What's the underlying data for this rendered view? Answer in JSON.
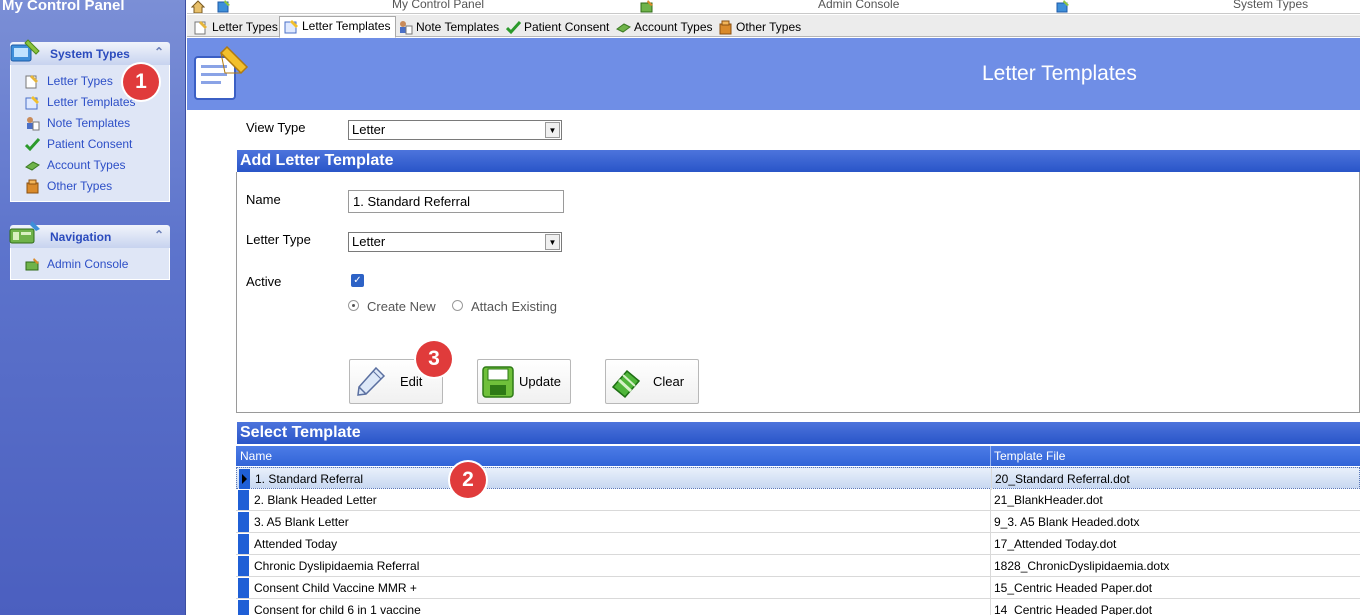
{
  "left_panel": {
    "title": "My Control Panel",
    "system_types": {
      "title": "System Types",
      "items": [
        {
          "label": "Letter Types",
          "icon": "letter-types-icon"
        },
        {
          "label": "Letter Templates",
          "icon": "letter-templates-icon"
        },
        {
          "label": "Note Templates",
          "icon": "note-templates-icon"
        },
        {
          "label": "Patient Consent",
          "icon": "checkmark-icon"
        },
        {
          "label": "Account Types",
          "icon": "account-types-icon"
        },
        {
          "label": "Other Types",
          "icon": "box-icon"
        }
      ]
    },
    "navigation": {
      "title": "Navigation",
      "items": [
        {
          "label": "Admin Console",
          "icon": "admin-console-icon"
        }
      ]
    }
  },
  "top_toolbar": {
    "items": [
      {
        "label": "My Control Panel"
      },
      {
        "label": "Admin Console"
      },
      {
        "label": "System Types"
      }
    ]
  },
  "tabs": [
    {
      "label": "Letter Types",
      "active": false
    },
    {
      "label": "Letter Templates",
      "active": true
    },
    {
      "label": "Note Templates",
      "active": false
    },
    {
      "label": "Patient Consent",
      "active": false
    },
    {
      "label": "Account Types",
      "active": false
    },
    {
      "label": "Other Types",
      "active": false
    }
  ],
  "header": {
    "title": "Letter Templates"
  },
  "form": {
    "view_type_label": "View Type",
    "view_type_value": "Letter",
    "add_section_title": "Add Letter Template",
    "name_label": "Name",
    "name_value": "1. Standard Referral",
    "letter_type_label": "Letter Type",
    "letter_type_value": "Letter",
    "active_label": "Active",
    "active_checked": true,
    "radio_create_new": "Create New",
    "radio_attach_existing": "Attach Existing",
    "selected_radio": "Create New",
    "buttons": {
      "edit": "Edit",
      "update": "Update",
      "clear": "Clear"
    }
  },
  "grid": {
    "section_title": "Select Template",
    "columns": [
      "Name",
      "Template File"
    ],
    "rows": [
      {
        "name": "1. Standard Referral",
        "file": "20_Standard Referral.dot",
        "selected": true
      },
      {
        "name": "2. Blank Headed Letter",
        "file": "21_BlankHeader.dot",
        "selected": false
      },
      {
        "name": "3. A5 Blank Letter",
        "file": "9_3. A5 Blank Headed.dotx",
        "selected": false
      },
      {
        "name": "Attended Today",
        "file": "17_Attended Today.dot",
        "selected": false
      },
      {
        "name": "Chronic Dyslipidaemia Referral",
        "file": "1828_ChronicDyslipidaemia.dotx",
        "selected": false
      },
      {
        "name": "Consent Child Vaccine MMR +",
        "file": "15_Centric Headed Paper.dot",
        "selected": false
      },
      {
        "name": "Consent for child 6 in 1 vaccine",
        "file": "14_Centric Headed Paper.dot",
        "selected": false
      }
    ]
  },
  "markers": [
    "1",
    "2",
    "3"
  ],
  "colors": {
    "accent_blue": "#2955c8",
    "header_blue": "#6f8ee6",
    "marker_red": "#e03b3b"
  }
}
